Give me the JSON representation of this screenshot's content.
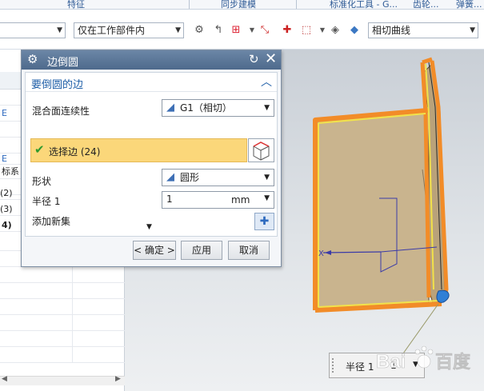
{
  "ribbon": {
    "groups": [
      "特征",
      "同步建模",
      "标准化工具 - G...",
      "齿轮...",
      "弹簧..."
    ]
  },
  "toolbar": {
    "scope_filter": "仅在工作部件内",
    "curve_rule": "相切曲线"
  },
  "navigator": {
    "rows": [
      {
        "text": ""
      },
      {
        "text": "E"
      },
      {
        "text": ""
      },
      {
        "text": ""
      },
      {
        "text": "E"
      },
      {
        "text": "标系"
      },
      {
        "text": ""
      },
      {
        "text": "(2)"
      },
      {
        "text": "(3)"
      },
      {
        "text": "4)"
      }
    ]
  },
  "dialog": {
    "title": "边倒圆",
    "group_title": "要倒圆的边",
    "blend_continuity_label": "混合面连续性",
    "blend_continuity_value": "G1（相切）",
    "select_edge_label": "选择边 (24)",
    "shape_label": "形状",
    "shape_value": "圆形",
    "radius_label": "半径 1",
    "radius_value": "1",
    "radius_unit": "mm",
    "add_new_set_label": "添加新集",
    "ok_button": "< 确定 >",
    "apply_button": "应用",
    "cancel_button": "取消"
  },
  "callout": {
    "label": "半径 1",
    "value": "1"
  },
  "watermark": {
    "text": "Bai百度"
  },
  "colors": {
    "selection_highlight": "#fbd77a",
    "part_face": "#c9b48e",
    "edge_highlight": "#f28c28",
    "accent_blue": "#1f5fa8"
  }
}
